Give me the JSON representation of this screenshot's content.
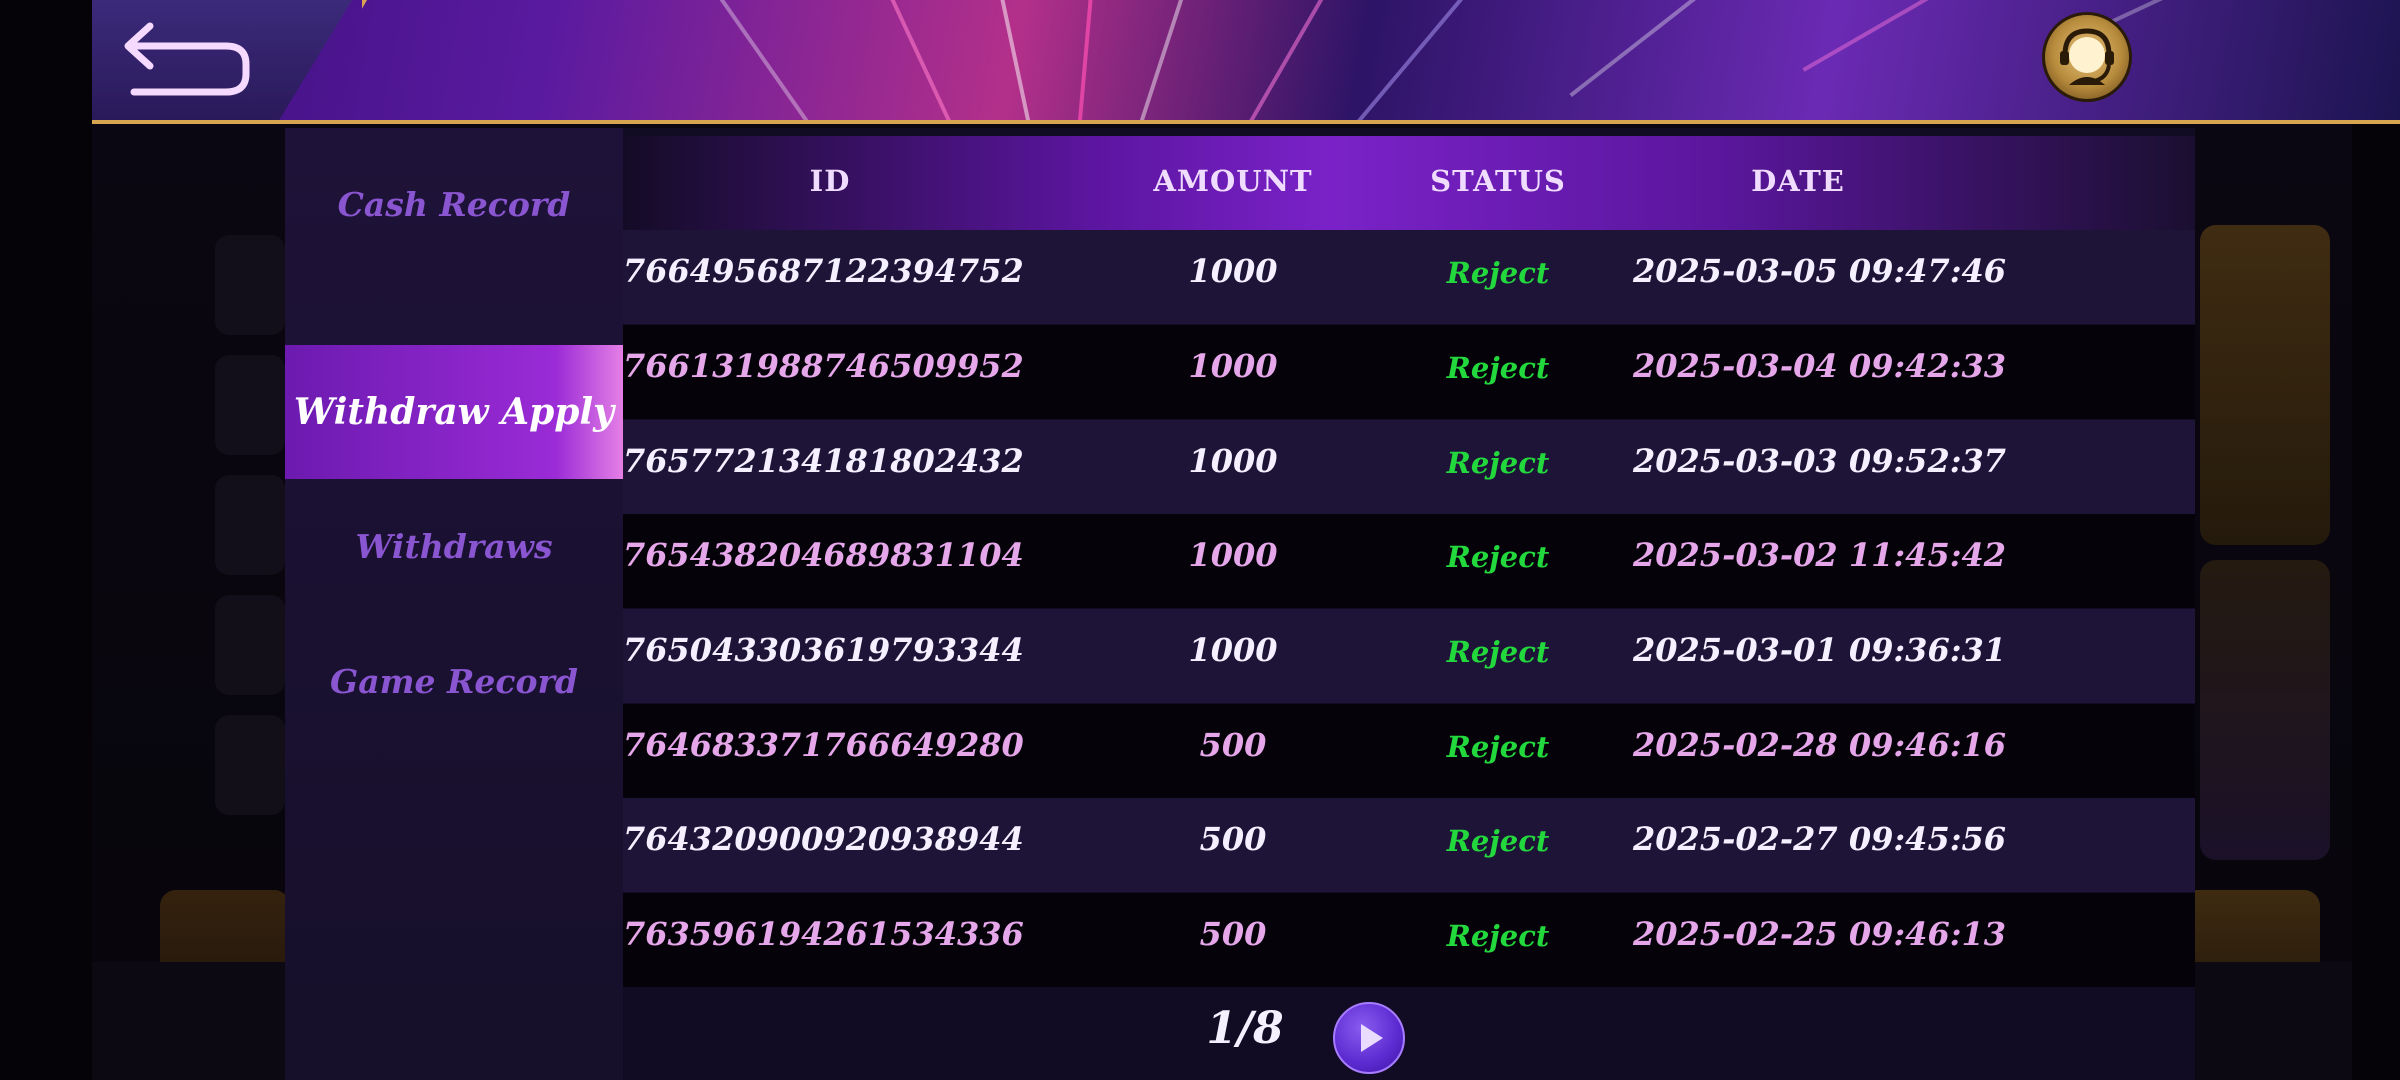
{
  "sidebar": {
    "items": [
      {
        "label": "Cash Record",
        "active": false
      },
      {
        "label": "Withdraw Apply",
        "active": true
      },
      {
        "label": "Withdraws",
        "active": false
      },
      {
        "label": "Game Record",
        "active": false
      }
    ]
  },
  "table": {
    "headers": {
      "id": "ID",
      "amount": "AMOUNT",
      "status": "STATUS",
      "date": "DATE"
    },
    "rows": [
      {
        "id": "766495687122394752",
        "amount": "1000",
        "status": "Reject",
        "date": "2025-03-05 09:47:46"
      },
      {
        "id": "766131988746509952",
        "amount": "1000",
        "status": "Reject",
        "date": "2025-03-04 09:42:33"
      },
      {
        "id": "765772134181802432",
        "amount": "1000",
        "status": "Reject",
        "date": "2025-03-03 09:52:37"
      },
      {
        "id": "765438204689831104",
        "amount": "1000",
        "status": "Reject",
        "date": "2025-03-02 11:45:42"
      },
      {
        "id": "765043303619793344",
        "amount": "1000",
        "status": "Reject",
        "date": "2025-03-01 09:36:31"
      },
      {
        "id": "764683371766649280",
        "amount": "500",
        "status": "Reject",
        "date": "2025-02-28 09:46:16"
      },
      {
        "id": "764320900920938944",
        "amount": "500",
        "status": "Reject",
        "date": "2025-02-27 09:45:56"
      },
      {
        "id": "763596194261534336",
        "amount": "500",
        "status": "Reject",
        "date": "2025-02-25 09:46:13"
      }
    ]
  },
  "pagination": {
    "label": "1/8"
  },
  "icons": {
    "back": "back-arrow-icon",
    "support": "customer-support-icon",
    "next": "play-next-icon"
  },
  "colors": {
    "accent": "#7a22c8",
    "status_reject": "#22d83c",
    "gold": "#d8a650"
  }
}
